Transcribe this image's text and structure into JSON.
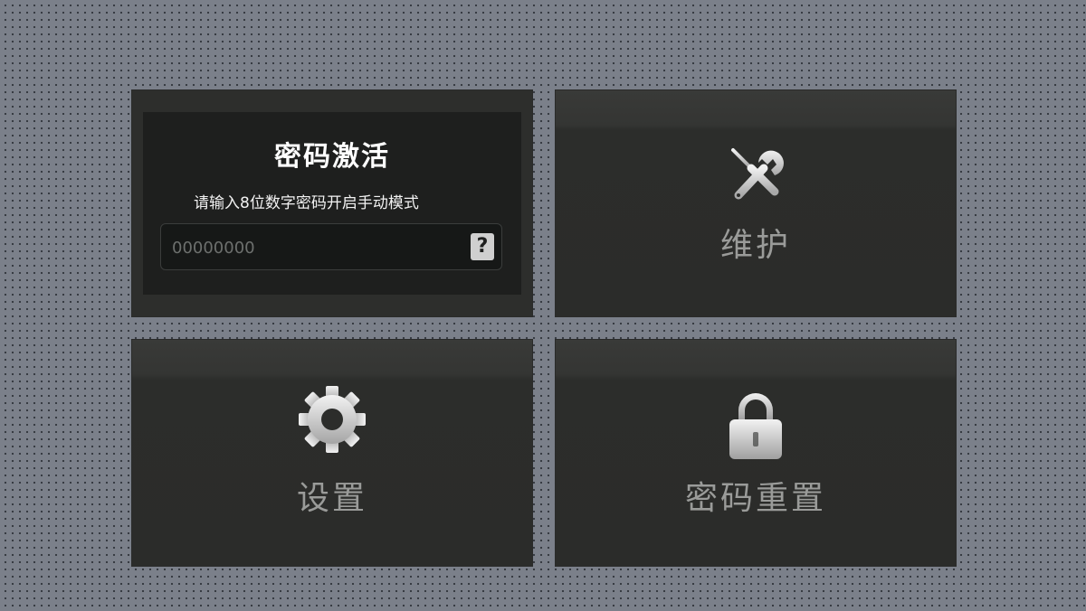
{
  "activation": {
    "title": "密码激活",
    "hint": "请输入8位数字密码开启手动模式",
    "password_placeholder": "00000000",
    "help_label": "?"
  },
  "tiles": {
    "maintain": {
      "label": "维护",
      "icon": "tools-icon"
    },
    "settings": {
      "label": "设置",
      "icon": "gear-icon"
    },
    "reset": {
      "label": "密码重置",
      "icon": "lock-icon"
    }
  },
  "colors": {
    "tile_bg": "#2d2e2c",
    "panel_bg": "#1e1f1e",
    "label_gray": "#9a9b99",
    "page_bg": "#7b808a"
  }
}
